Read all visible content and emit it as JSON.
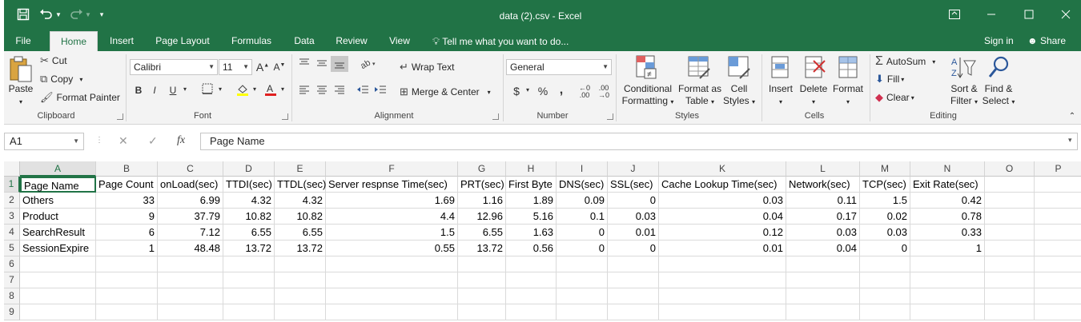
{
  "title": "data (2).csv - Excel",
  "quick_access": {
    "save_icon": "save-icon",
    "undo_icon": "undo-icon",
    "redo_icon": "redo-icon",
    "customize_icon": "chevron-down-icon"
  },
  "tabs": [
    "File",
    "Home",
    "Insert",
    "Page Layout",
    "Formulas",
    "Data",
    "Review",
    "View"
  ],
  "active_tab": "Home",
  "tell_me": "Tell me what you want to do...",
  "sign_in": "Sign in",
  "share": "Share",
  "ribbon": {
    "clipboard": {
      "paste": "Paste",
      "cut": "Cut",
      "copy": "Copy",
      "format_painter": "Format Painter",
      "label": "Clipboard"
    },
    "font": {
      "font_name": "Calibri",
      "font_size": "11",
      "bold": "B",
      "italic": "I",
      "underline": "U",
      "label": "Font"
    },
    "alignment": {
      "wrap_text": "Wrap Text",
      "merge_center": "Merge & Center",
      "label": "Alignment"
    },
    "number": {
      "format": "General",
      "currency": "$",
      "percent": "%",
      "comma": ",",
      "label": "Number"
    },
    "styles": {
      "conditional": "Conditional",
      "conditional2": "Formatting",
      "format_table": "Format as",
      "format_table2": "Table",
      "cell_styles": "Cell",
      "cell_styles2": "Styles",
      "label": "Styles"
    },
    "cells": {
      "insert": "Insert",
      "delete": "Delete",
      "format": "Format",
      "label": "Cells"
    },
    "editing": {
      "autosum": "AutoSum",
      "fill": "Fill",
      "clear": "Clear",
      "sort_filter": "Sort &",
      "sort_filter2": "Filter",
      "find_select": "Find &",
      "find_select2": "Select",
      "label": "Editing"
    }
  },
  "name_box": "A1",
  "formula_value": "Page Name",
  "columns": [
    "A",
    "B",
    "C",
    "D",
    "E",
    "F",
    "G",
    "H",
    "I",
    "J",
    "K",
    "L",
    "M",
    "N",
    "O",
    "P"
  ],
  "rows": [
    "1",
    "2",
    "3",
    "4",
    "5",
    "6",
    "7",
    "8",
    "9"
  ],
  "sheet": [
    [
      "Page Name",
      "Page Count",
      "onLoad(sec)",
      "TTDI(sec)",
      "TTDL(sec)",
      "Server respnse Time(sec)",
      "PRT(sec)",
      "First Byte",
      "DNS(sec)",
      "SSL(sec)",
      "Cache Lookup Time(sec)",
      "Network(sec)",
      "TCP(sec)",
      "Exit Rate(sec)",
      "",
      ""
    ],
    [
      "Others",
      "33",
      "6.99",
      "4.32",
      "4.32",
      "1.69",
      "1.16",
      "1.89",
      "0.09",
      "0",
      "0.03",
      "0.11",
      "1.5",
      "0.42",
      "",
      ""
    ],
    [
      "Product",
      "9",
      "37.79",
      "10.82",
      "10.82",
      "4.4",
      "12.96",
      "5.16",
      "0.1",
      "0.03",
      "0.04",
      "0.17",
      "0.02",
      "0.78",
      "",
      ""
    ],
    [
      "SearchResult",
      "6",
      "7.12",
      "6.55",
      "6.55",
      "1.5",
      "6.55",
      "1.63",
      "0",
      "0.01",
      "0.12",
      "0.03",
      "0.03",
      "0.33",
      "",
      ""
    ],
    [
      "SessionExpire",
      "1",
      "48.48",
      "13.72",
      "13.72",
      "0.55",
      "13.72",
      "0.56",
      "0",
      "0",
      "0.01",
      "0.04",
      "0",
      "1",
      "",
      ""
    ],
    [
      "",
      "",
      "",
      "",
      "",
      "",
      "",
      "",
      "",
      "",
      "",
      "",
      "",
      "",
      "",
      ""
    ],
    [
      "",
      "",
      "",
      "",
      "",
      "",
      "",
      "",
      "",
      "",
      "",
      "",
      "",
      "",
      "",
      ""
    ],
    [
      "",
      "",
      "",
      "",
      "",
      "",
      "",
      "",
      "",
      "",
      "",
      "",
      "",
      "",
      "",
      ""
    ],
    [
      "",
      "",
      "",
      "",
      "",
      "",
      "",
      "",
      "",
      "",
      "",
      "",
      "",
      "",
      "",
      ""
    ]
  ],
  "accent_color": "#217346"
}
